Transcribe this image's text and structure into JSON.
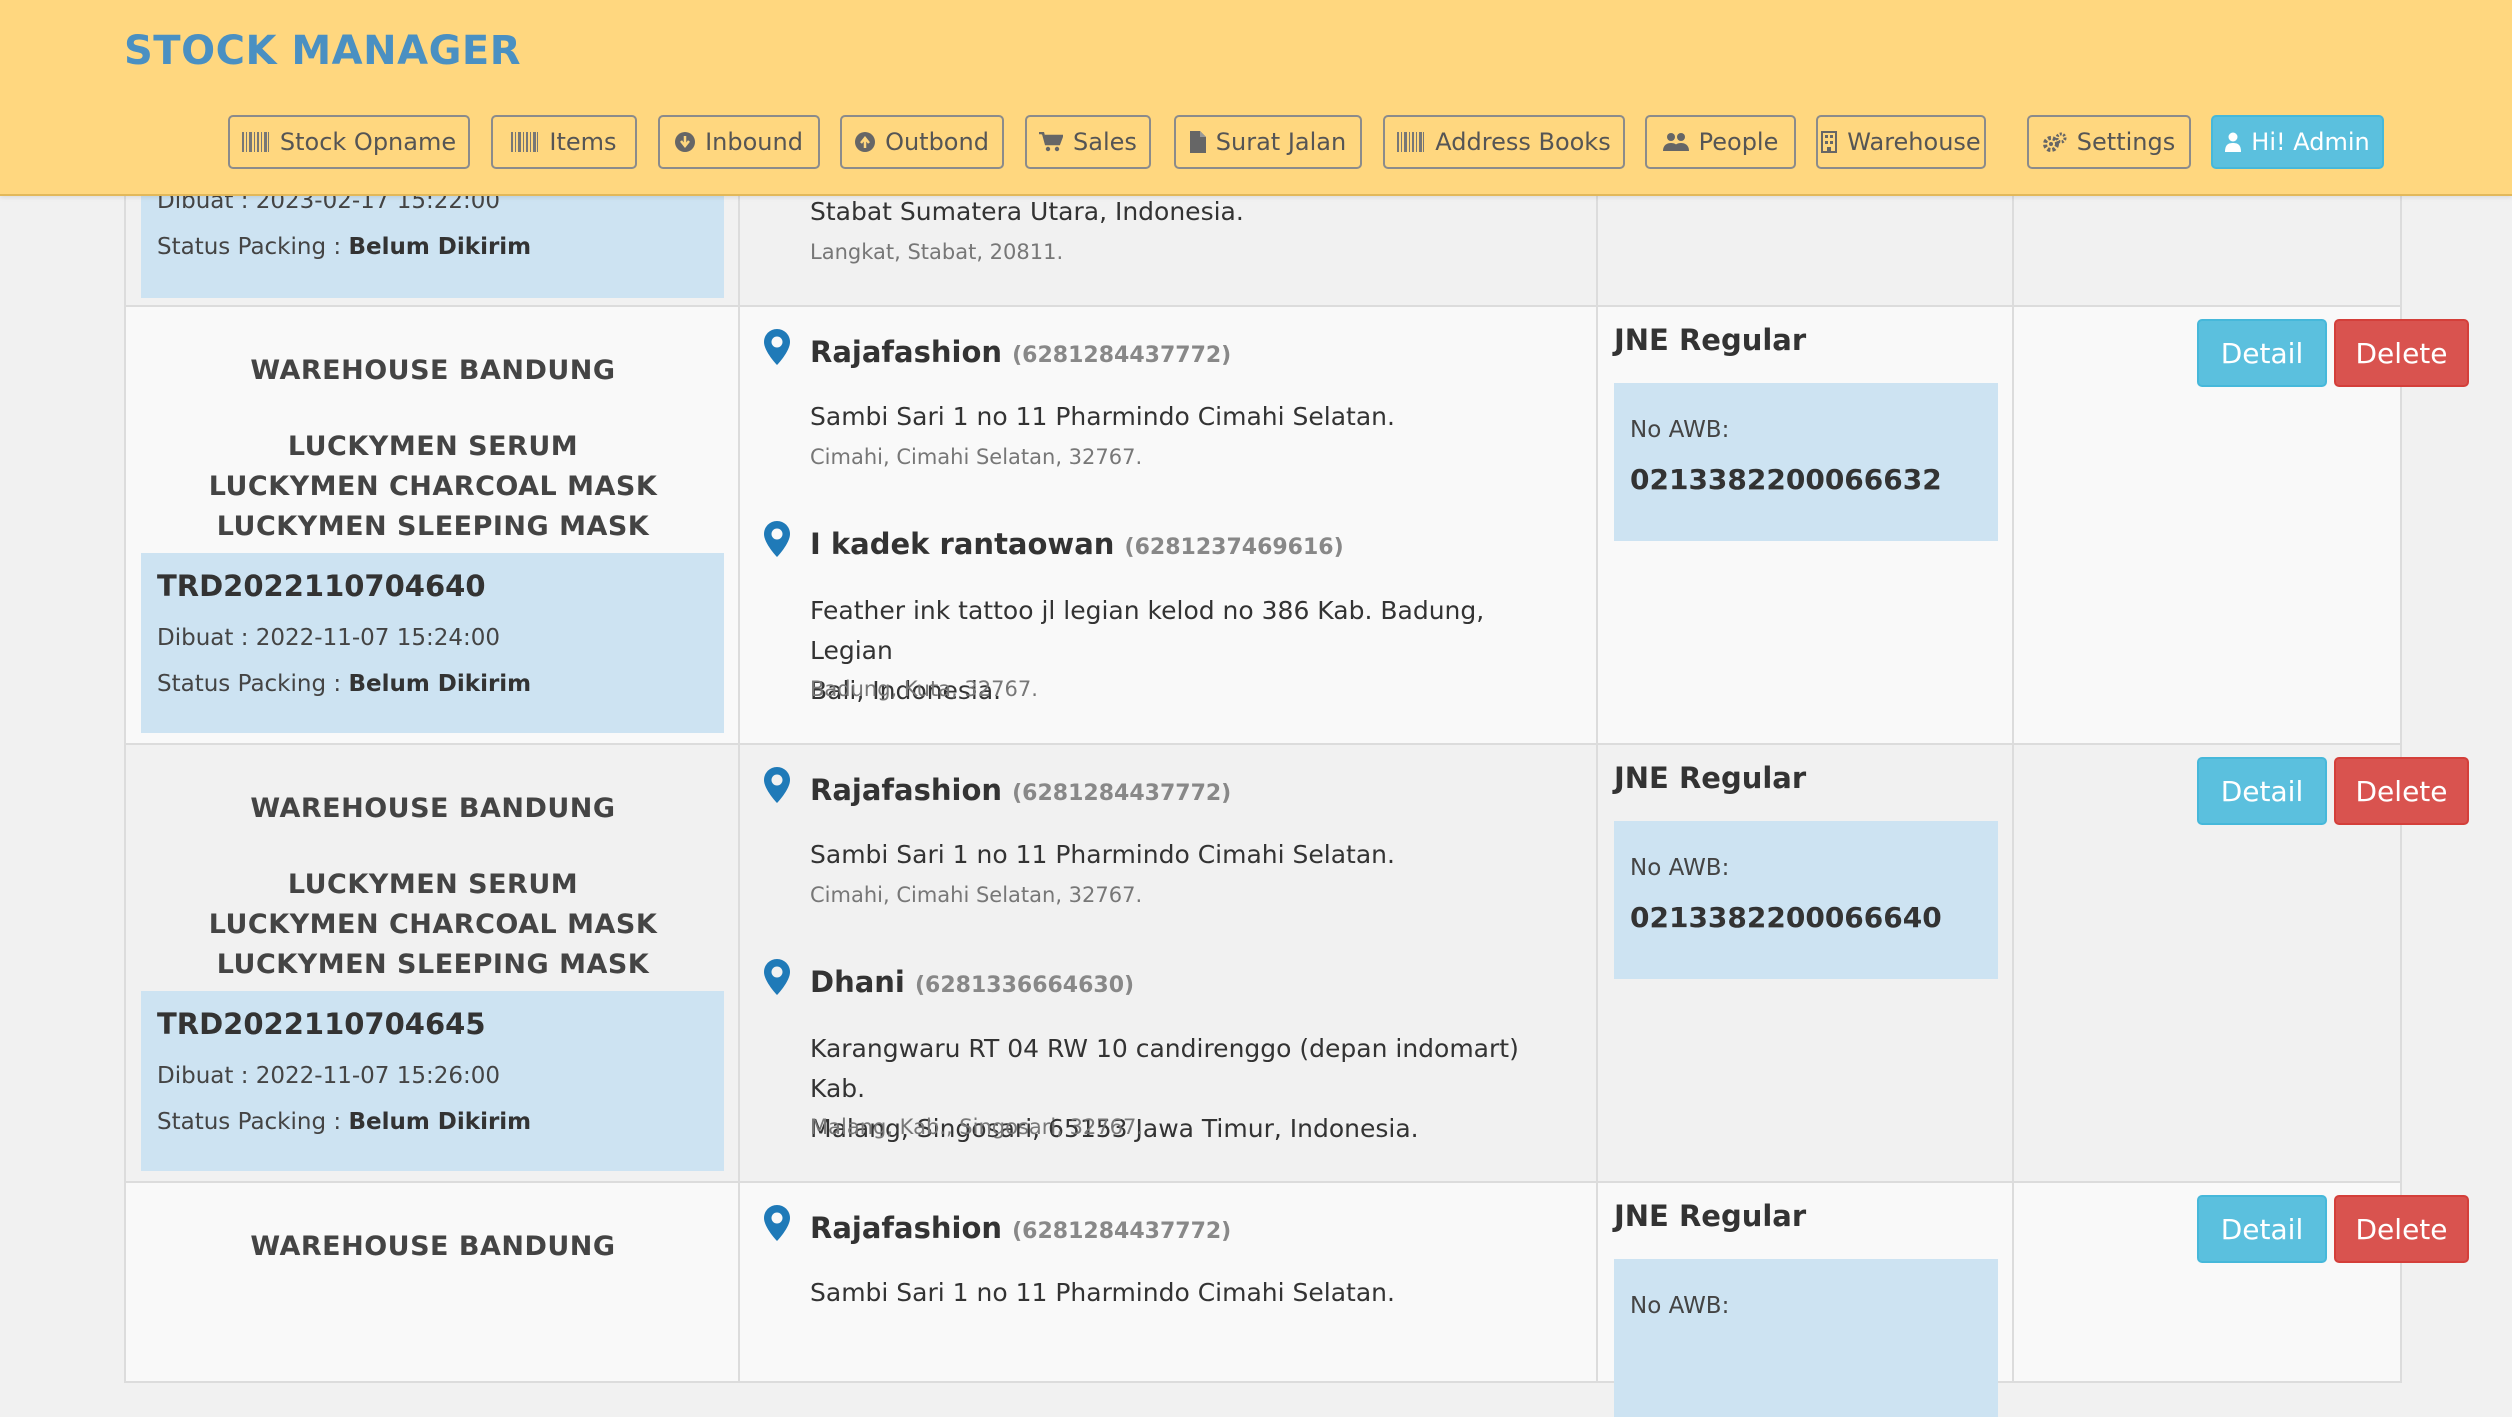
{
  "app": {
    "brand": "STOCK MANAGER"
  },
  "nav": [
    {
      "label": "Stock Opname",
      "icon": "barcode-icon"
    },
    {
      "label": "Items",
      "icon": "barcode-icon"
    },
    {
      "label": "Inbound",
      "icon": "arrow-circle-down-icon"
    },
    {
      "label": "Outbond",
      "icon": "arrow-circle-up-icon"
    },
    {
      "label": "Sales",
      "icon": "shopping-cart-icon"
    },
    {
      "label": "Surat Jalan",
      "icon": "file-icon"
    },
    {
      "label": "Address Books",
      "icon": "barcode-icon"
    },
    {
      "label": "People",
      "icon": "users-icon"
    },
    {
      "label": "Warehouse",
      "icon": "building-icon"
    },
    {
      "label": "Settings",
      "icon": "gears-icon"
    },
    {
      "label": "Hi! Admin",
      "icon": "user-icon"
    }
  ],
  "partial_top": {
    "dibuat": "Dibuat : 2023-02-17 15:22:00",
    "status_prefix": "Status Packing : ",
    "status_value": "Belum Dikirim",
    "address": "Stabat Sumatera Utara, Indonesia.",
    "city": "Langkat, Stabat, 20811."
  },
  "buttons": {
    "detail": "Detail",
    "delete": "Delete"
  },
  "labels": {
    "awb": "No AWB:"
  },
  "rows": [
    {
      "warehouse": "WAREHOUSE BANDUNG",
      "products": [
        "LUCKYMEN SERUM",
        "LUCKYMEN CHARCOAL MASK",
        "LUCKYMEN SLEEPING MASK"
      ],
      "order_no": "TRD2022110704640",
      "dibuat": "Dibuat : 2022-11-07 15:24:00",
      "status_prefix": "Status Packing : ",
      "status_value": "Belum Dikirim",
      "sender": {
        "name": "Rajafashion",
        "phone": "(6281284437772)",
        "address": [
          "Sambi Sari 1 no 11 Pharmindo Cimahi Selatan."
        ],
        "city": "Cimahi, Cimahi Selatan, 32767."
      },
      "receiver": {
        "name": "I kadek rantaowan",
        "phone": "(6281237469616)",
        "address": [
          "Feather ink tattoo jl legian kelod no 386 Kab. Badung, Legian",
          "Bali, Indonesia."
        ],
        "city": "Badung, Kuta, 32767."
      },
      "courier": "JNE Regular",
      "awb": "0213382200066632"
    },
    {
      "warehouse": "WAREHOUSE BANDUNG",
      "products": [
        "LUCKYMEN SERUM",
        "LUCKYMEN CHARCOAL MASK",
        "LUCKYMEN SLEEPING MASK"
      ],
      "order_no": "TRD2022110704645",
      "dibuat": "Dibuat : 2022-11-07 15:26:00",
      "status_prefix": "Status Packing : ",
      "status_value": "Belum Dikirim",
      "sender": {
        "name": "Rajafashion",
        "phone": "(6281284437772)",
        "address": [
          "Sambi Sari 1 no 11 Pharmindo Cimahi Selatan."
        ],
        "city": "Cimahi, Cimahi Selatan, 32767."
      },
      "receiver": {
        "name": "Dhani",
        "phone": "(6281336664630)",
        "address": [
          "Karangwaru RT 04 RW 10 candirenggo (depan indomart) Kab.",
          "Malang, Singosari, 65153 Jawa Timur, Indonesia."
        ],
        "city": "Malang, Kab., Singosari, 32767."
      },
      "courier": "JNE Regular",
      "awb": "0213382200066640"
    },
    {
      "warehouse": "WAREHOUSE BANDUNG",
      "sender": {
        "name": "Rajafashion",
        "phone": "(6281284437772)",
        "address": [
          "Sambi Sari 1 no 11 Pharmindo Cimahi Selatan."
        ]
      },
      "courier": "JNE Regular",
      "awb_label": "No AWB:"
    }
  ]
}
